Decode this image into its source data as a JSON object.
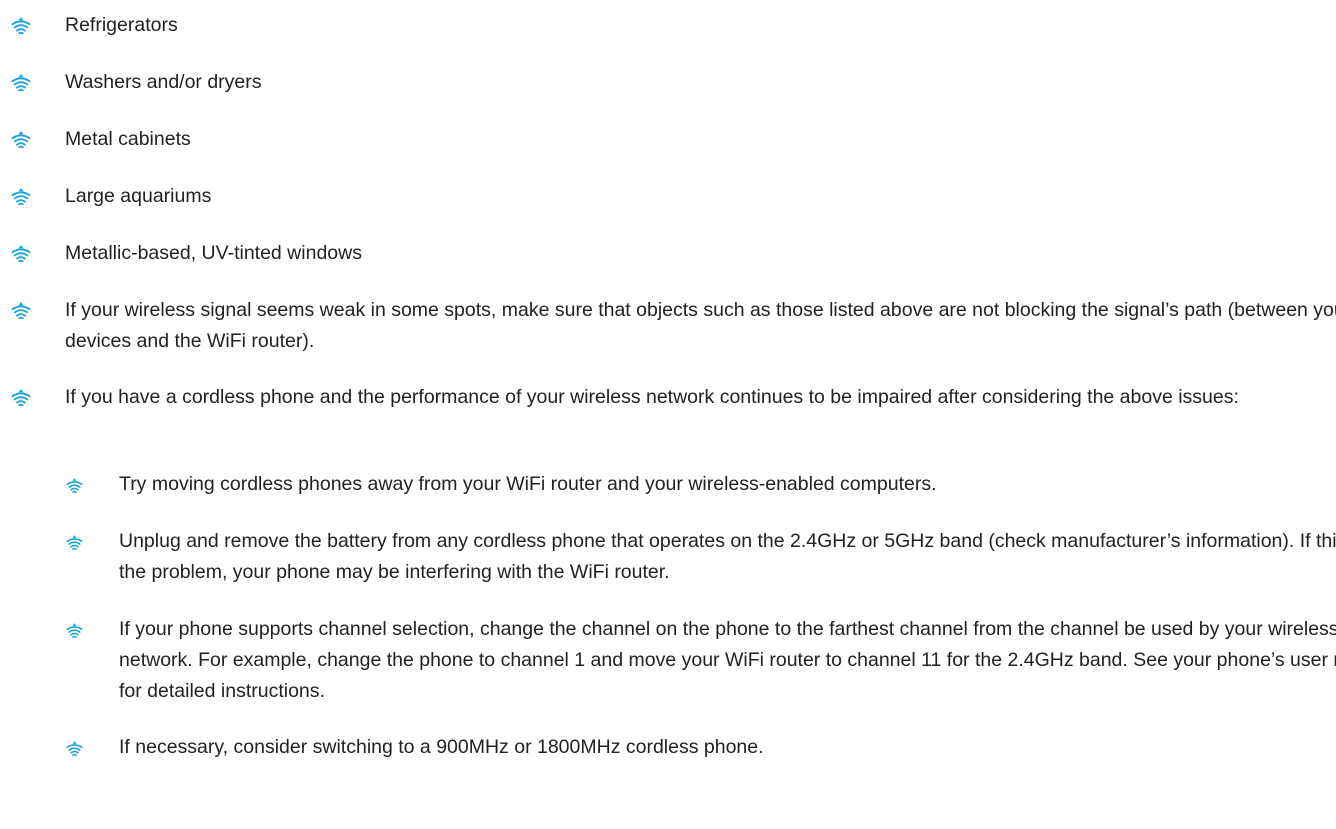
{
  "bullet_color": "#1fa3d8",
  "bullet_icon": "wifi-signal-icon",
  "list": {
    "items": [
      {
        "text": "Refrigerators"
      },
      {
        "text": "Washers and/or dryers"
      },
      {
        "text": "Metal cabinets"
      },
      {
        "text": "Large aquariums"
      },
      {
        "text": "Metallic-based, UV-tinted windows"
      },
      {
        "text": "If your wireless signal seems weak in some spots, make sure that objects such as those listed above are not blocking the signal’s path (between your devices and the WiFi router)."
      },
      {
        "text": "If you have a cordless phone and the performance of your wireless network continues to be impaired after considering the above issues:"
      }
    ],
    "subitems": [
      {
        "text": "Try moving cordless phones away from your WiFi router and your wireless-enabled computers."
      },
      {
        "text": "Unplug and remove the battery from any cordless phone that operates on the 2.4GHz or 5GHz band (check manufacturer’s information). If this fixes the problem, your phone may be interfering with the WiFi router."
      },
      {
        "text": "If your phone supports channel selection, change the channel on the phone to the farthest channel from the channel be used by your wireless network. For example, change the phone to channel 1 and move your WiFi router to channel 11 for the 2.4GHz band. See your phone’s user manual for detailed instructions."
      },
      {
        "text": "If necessary, consider switching to a 900MHz or 1800MHz cordless phone."
      }
    ]
  }
}
